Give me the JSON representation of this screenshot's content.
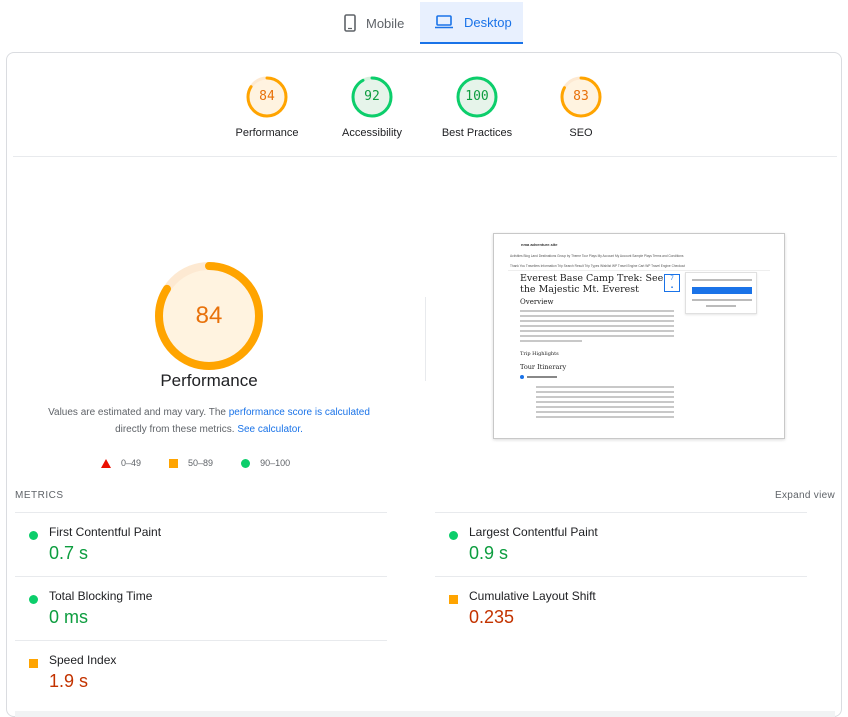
{
  "tabs": {
    "mobile": {
      "label": "Mobile",
      "icon": "phone-icon"
    },
    "desktop": {
      "label": "Desktop",
      "icon": "laptop-icon",
      "selected": true
    }
  },
  "categories": [
    {
      "name": "Performance",
      "score": "84",
      "color": "#e8710a"
    },
    {
      "name": "Accessibility",
      "score": "92",
      "color": "#0d9d3f"
    },
    {
      "name": "Best Practices",
      "score": "100",
      "color": "#0d9d3f"
    },
    {
      "name": "SEO",
      "score": "83",
      "color": "#e8710a"
    }
  ],
  "performance": {
    "score": "84",
    "title": "Performance",
    "desc_prefix": "Values are estimated and may vary. The ",
    "desc_link1": "performance score is calculated",
    "desc_middle": " directly from these metrics. ",
    "desc_link2": "See calculator."
  },
  "legend": {
    "poor": "0–49",
    "average": "50–89",
    "good": "90–100"
  },
  "screenshot": {
    "site_name": "nma adventure.site",
    "nav_row1": "Activities   Blog Land   Destinations   Group by Theme Tour Plays   My Account   My Account   Sample Plays   Terms and Conditions",
    "nav_row2": "Thank You   Travellers Information   Trip Search Result   Trip Types   Wishlist   WP Travel Engine Cart   WP Travel Engine Checkout",
    "headline": "Everest Base Camp Trek: See the Majestic Mt. Everest",
    "overview": "Overview",
    "trip_highlights": "Trip Highlights",
    "tour_itinerary": "Tour Itinerary"
  },
  "metrics": {
    "heading": "METRICS",
    "expand": "Expand view",
    "items": [
      {
        "name": "First Contentful Paint",
        "value": "0.7 s",
        "rating": "good"
      },
      {
        "name": "Largest Contentful Paint",
        "value": "0.9 s",
        "rating": "good"
      },
      {
        "name": "Total Blocking Time",
        "value": "0 ms",
        "rating": "good"
      },
      {
        "name": "Cumulative Layout Shift",
        "value": "0.235",
        "rating": "average"
      },
      {
        "name": "Speed Index",
        "value": "1.9 s",
        "rating": "average"
      }
    ]
  },
  "colors": {
    "accent": "#1a73e8",
    "pass": "#0cce6b",
    "average": "#ffa400",
    "fail": "#eb0f00"
  }
}
